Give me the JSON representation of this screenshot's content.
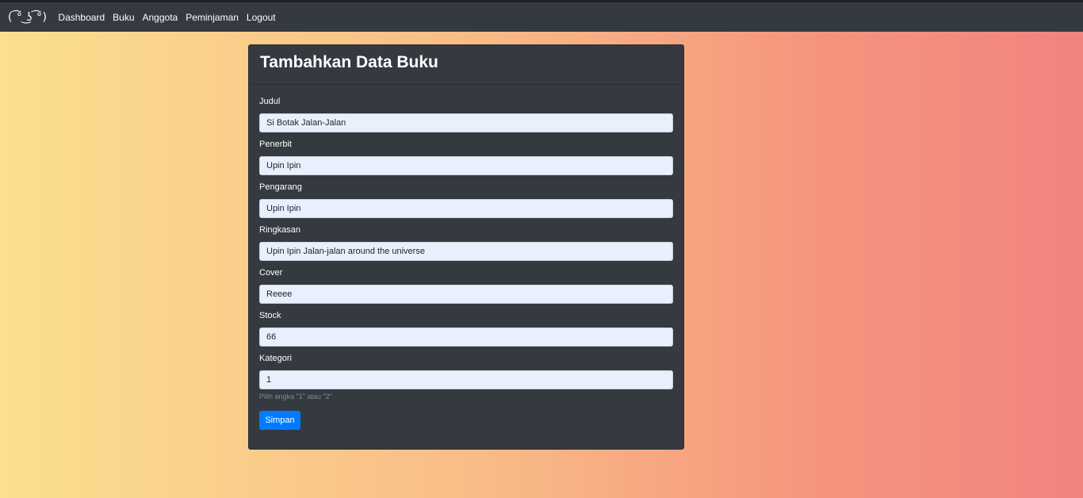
{
  "nav": {
    "brand": "( ͡° ͜ʖ ͡°)",
    "links": [
      "Dashboard",
      "Buku",
      "Anggota",
      "Peminjaman",
      "Logout"
    ]
  },
  "form": {
    "title": "Tambahkan Data Buku",
    "fields": [
      {
        "label": "Judul",
        "value": "Si Botak Jalan-Jalan"
      },
      {
        "label": "Penerbit",
        "value": "Upin Ipin"
      },
      {
        "label": "Pengarang",
        "value": "Upin Ipin"
      },
      {
        "label": "Ringkasan",
        "value": "Upin Ipin Jalan-jalan around the universe"
      },
      {
        "label": "Cover",
        "value": "Reeee"
      },
      {
        "label": "Stock",
        "value": "66"
      },
      {
        "label": "Kategori",
        "value": "1"
      }
    ],
    "kategori_help": "Pilih angka \"1\" atau \"2\"",
    "submit_label": "Simpan"
  },
  "colors": {
    "navbar": "#343a40",
    "card": "#343a40",
    "input_bg": "#e8f0fe",
    "button": "#007bff",
    "gradient_left": "#fbe08f",
    "gradient_right": "#f2837f"
  }
}
